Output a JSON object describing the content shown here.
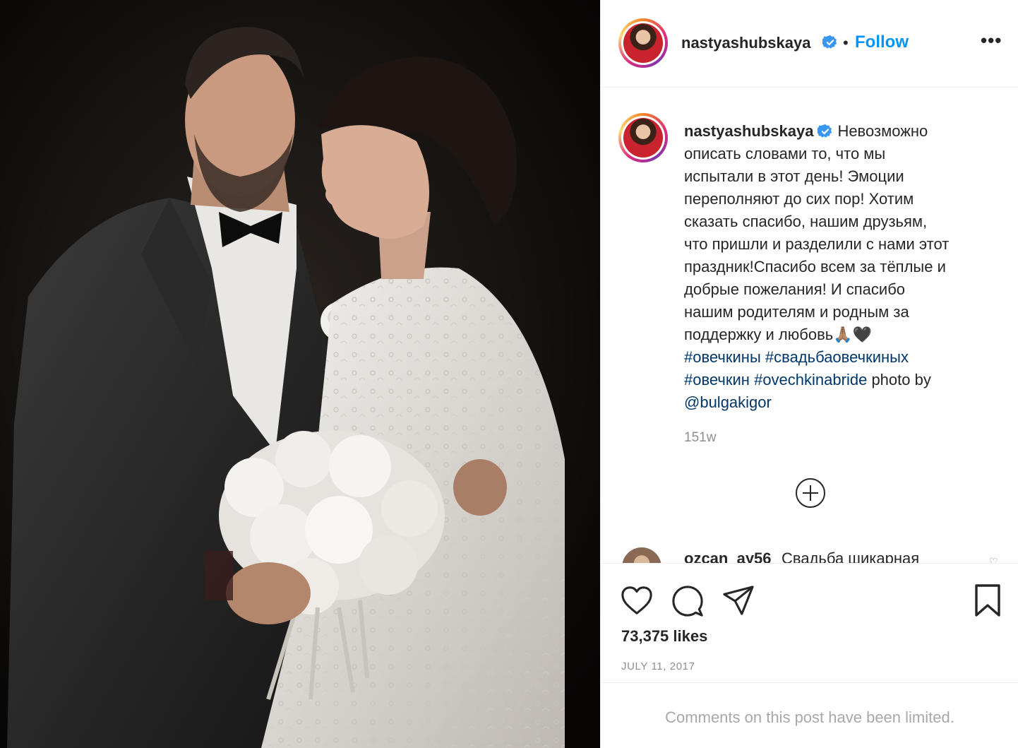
{
  "post": {
    "username": "nastyashubskaya",
    "follow_label": "Follow",
    "separator": "•",
    "more_label": "•••",
    "caption_user": "nastyashubskaya",
    "caption_lines": [
      "Невозможно",
      "описать словами то, что мы",
      "испытали в этот день! Эмоции",
      "переполняют до сих пор! Хотим",
      "сказать спасибо, нашим друзьям,",
      "что пришли и разделили с нами этот",
      "праздник!Спасибо всем за тёплые и",
      "добрые пожелания! И спасибо",
      "нашим родителям и родным за",
      "поддержку и любовь🙏🏽🖤"
    ],
    "hashtag_1": "#овечкины",
    "hashtag_2": "#свадьбаовечкиных",
    "hashtag_3": "#овечкин",
    "hashtag_4": "#ovechkinabride",
    "photo_by": "photo by",
    "mention": "@bulgakigor",
    "time_ago": "151w",
    "likes": "73,375 likes",
    "date": "JULY 11, 2017",
    "comments_limited": "Comments on this post have been limited."
  },
  "next_comment": {
    "user": "ozcan_ay56",
    "text": "Свадьба шикарная"
  },
  "icons": {
    "like": "heart-icon",
    "comment": "comment-icon",
    "share": "share-icon",
    "save": "bookmark-icon",
    "verified": "verified-badge-icon",
    "load_more": "plus-circle-icon"
  },
  "colors": {
    "link": "#0095f6",
    "hashtag": "#00376b",
    "muted": "#8e8e8e",
    "verified": "#3897f0"
  }
}
